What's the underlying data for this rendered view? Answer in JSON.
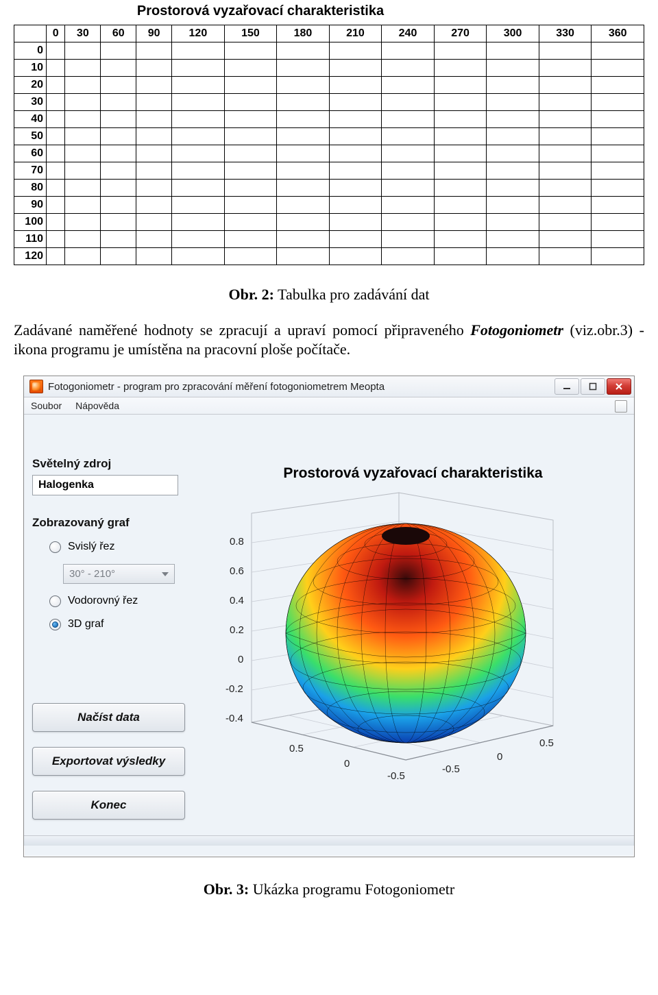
{
  "top_title": "Prostorová vyzařovací charakteristika",
  "table": {
    "col_headers": [
      "0",
      "30",
      "60",
      "90",
      "120",
      "150",
      "180",
      "210",
      "240",
      "270",
      "300",
      "330",
      "360"
    ],
    "row_headers": [
      "0",
      "10",
      "20",
      "30",
      "40",
      "50",
      "60",
      "70",
      "80",
      "90",
      "100",
      "110",
      "120"
    ]
  },
  "caption1": {
    "label": "Obr. 2:",
    "text": " Tabulka pro zadávání dat"
  },
  "paragraph": {
    "before": "Zadávané naměřené hodnoty se zpracují a upraví pomocí připraveného ",
    "italic": "Fotogoniometr",
    "after": " (viz.obr.3) - ikona programu je umístěna na pracovní ploše počítače."
  },
  "app": {
    "title": "Fotogoniometr - program pro zpracování měření fotogoniometrem Meopta",
    "menu": {
      "soubor": "Soubor",
      "napoveda": "Nápověda"
    },
    "left": {
      "source_label": "Světelný zdroj",
      "source_value": "Halogenka",
      "graph_label": "Zobrazovaný graf",
      "opt_svisly": "Svislý řez",
      "combo_value": "30° - 210°",
      "opt_vodorovny": "Vodorovný řez",
      "opt_3d": "3D graf",
      "btn_load": "Načíst data",
      "btn_export": "Exportovat výsledky",
      "btn_end": "Konec"
    },
    "chart": {
      "title": "Prostorová vyzařovací charakteristika",
      "z_ticks": [
        "0.8",
        "0.6",
        "0.4",
        "0.2",
        "0",
        "-0.2",
        "-0.4"
      ],
      "xy_ticks": [
        "0.5",
        "0",
        "-0.5"
      ]
    }
  },
  "caption2": {
    "label": "Obr. 3:",
    "text": " Ukázka programu Fotogoniometr"
  },
  "chart_data": {
    "type": "table",
    "title": "Prostorová vyzařovací charakteristika",
    "columns": [
      0,
      30,
      60,
      90,
      120,
      150,
      180,
      210,
      240,
      270,
      300,
      330,
      360
    ],
    "rows": [
      0,
      10,
      20,
      30,
      40,
      50,
      60,
      70,
      80,
      90,
      100,
      110,
      120
    ],
    "values": null,
    "note": "Empty grid template for manual data entry of goniophotometric measurements"
  }
}
